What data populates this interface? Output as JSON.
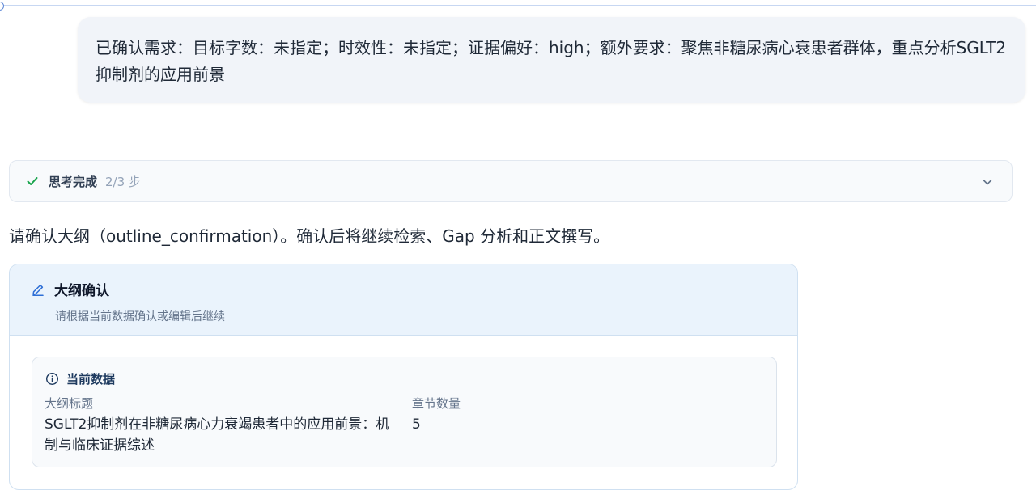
{
  "user_message": {
    "text": "已确认需求：目标字数：未指定；时效性：未指定；证据偏好：high；额外要求：聚焦非糖尿病心衰患者群体，重点分析SGLT2抑制剂的应用前景"
  },
  "thinking": {
    "status": "思考完成",
    "steps": "2/3 步",
    "check_icon": "check-icon",
    "toggle_icon": "chevron-down-icon"
  },
  "assistant": {
    "prompt": "请确认大纲（outline_confirmation）。确认后将继续检索、Gap 分析和正文撰写。"
  },
  "card": {
    "icon": "edit-icon",
    "title": "大纲确认",
    "subtitle": "请根据当前数据确认或编辑后继续",
    "current": {
      "icon": "info-icon",
      "title": "当前数据",
      "outline_title_label": "大纲标题",
      "outline_title_value": "SGLT2抑制剂在非糖尿病心力衰竭患者中的应用前景：机制与临床证据综述",
      "section_count_label": "章节数量",
      "section_count_value": "5"
    }
  },
  "colors": {
    "accent": "#16a34a",
    "link": "#2f6fd6",
    "card_header_bg": "#eaf3fc"
  }
}
